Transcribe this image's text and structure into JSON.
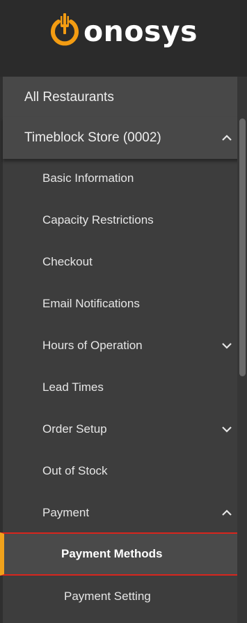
{
  "brand": {
    "name": "onosys",
    "accent": "#f39c12"
  },
  "nav": {
    "all_restaurants": "All Restaurants",
    "store": {
      "label": "Timeblock Store (0002)",
      "chevron": "chevron-up-icon"
    },
    "items": [
      {
        "label": "Basic Information"
      },
      {
        "label": "Capacity Restrictions"
      },
      {
        "label": "Checkout"
      },
      {
        "label": "Email Notifications"
      },
      {
        "label": "Hours of Operation",
        "chevron": "chevron-down-icon"
      },
      {
        "label": "Lead Times"
      },
      {
        "label": "Order Setup",
        "chevron": "chevron-down-icon"
      },
      {
        "label": "Out of Stock"
      },
      {
        "label": "Payment",
        "chevron": "chevron-up-icon"
      }
    ],
    "payment_sub": [
      {
        "label": "Payment Methods",
        "active": true
      },
      {
        "label": "Payment Setting"
      }
    ]
  }
}
